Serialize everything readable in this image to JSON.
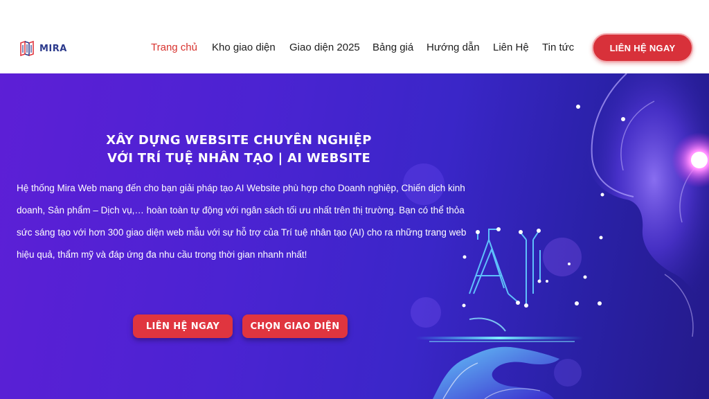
{
  "header": {
    "logo_text": "MIRA",
    "nav": [
      {
        "label": "Trang chủ",
        "active": true
      },
      {
        "label": "Kho giao diện",
        "active": false
      },
      {
        "label": "Giao diện 2025",
        "active": false
      },
      {
        "label": "Bảng giá",
        "active": false
      },
      {
        "label": "Hướng dẫn",
        "active": false
      },
      {
        "label": "Liên Hệ",
        "active": false
      },
      {
        "label": "Tin tức",
        "active": false
      }
    ],
    "cta_label": "LIÊN HỆ NGAY"
  },
  "hero": {
    "title_line1": "XÂY DỰNG WEBSITE CHUYÊN NGHIỆP",
    "title_line2": "VỚI TRÍ TUỆ NHÂN TẠO | AI WEBSITE",
    "description": "Hệ thống Mira Web mang đến cho bạn giải pháp tạo AI Website phù hợp cho Doanh nghiệp, Chiến dịch kinh doanh, Sản phẩm – Dịch vụ,… hoàn toàn tự động với ngân sách tối ưu nhất trên thị trường. Bạn có thể thỏa sức sáng tạo với hơn 300 giao diện web mẫu với sự hỗ trợ của Trí tuệ nhân tạo (AI) cho ra những trang web hiệu quả, thẩm mỹ và đáp ứng đa nhu cầu trong thời gian nhanh nhất!",
    "button_contact": "LIÊN HỆ NGAY",
    "button_choose": "CHỌN GIAO DIỆN",
    "art_text": "AI"
  },
  "colors": {
    "accent_red": "#d8313a",
    "nav_active": "#d8332f",
    "hero_bg": "#4b23d2"
  }
}
